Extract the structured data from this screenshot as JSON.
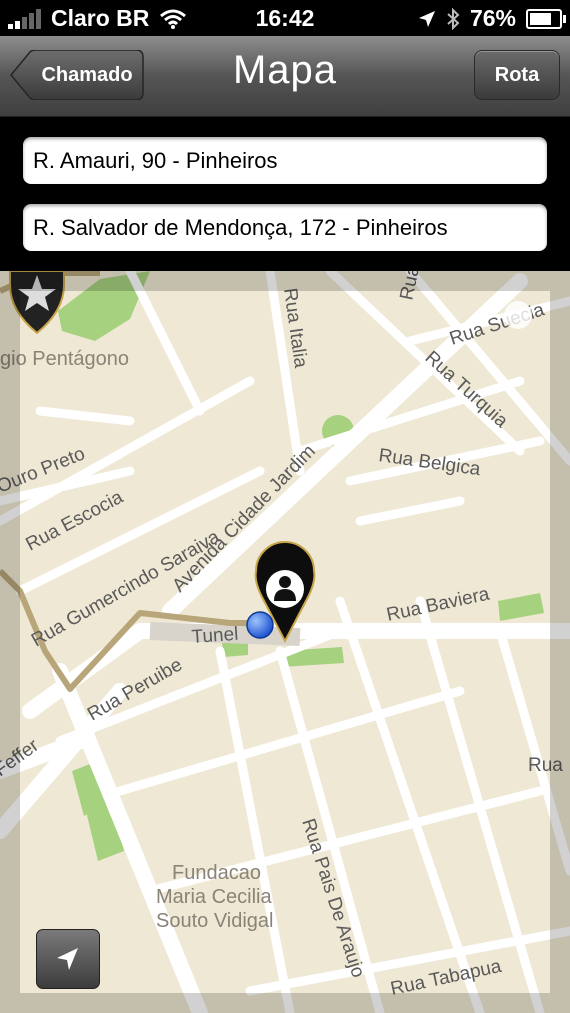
{
  "status_bar": {
    "carrier": "Claro BR",
    "time": "16:42",
    "battery": "76%",
    "battery_level": 0.76
  },
  "nav": {
    "back_label": "Chamado",
    "title": "Mapa",
    "right_label": "Rota"
  },
  "fields": {
    "origin": "R. Amauri, 90 - Pinheiros",
    "destination": "R. Salvador de Mendonça, 172 - Pinheiros"
  },
  "map": {
    "labels": {
      "rua_italia": "Rua Italia",
      "rua_suecia": "Rua Suecia",
      "rua_turquia": "Rua Turquia",
      "rua_belgica": "Rua Belgica",
      "ouro_preto": "Ouro Preto",
      "rua_escocia": "Rua Escocia",
      "av_cidade_jardim": "Avenida Cidade Jardim",
      "rua_gumercindo": "Rua Gumercindo Saraiva",
      "rua_baviera": "Rua Baviera",
      "tunel": "Tunel",
      "rua_peruibe": "Rua Peruibe",
      "feffer": "Feffer",
      "rua_pais_de_araujo": "Rua Pais De Araujo",
      "rua_tabapua": "Rua Tabapua",
      "rua_right": "Rua",
      "rua_top": "Rua",
      "colegio": "gio Pentágono",
      "fundacao_1": "Fundacao",
      "fundacao_2": "Maria Cecilia",
      "fundacao_3": "Souto Vidigal"
    }
  },
  "colors": {
    "map_background": "#efe8d4",
    "park": "#a6d17f",
    "route": "#b8a67a",
    "marker": "#000000",
    "user_dot": "#1e5fe0"
  }
}
